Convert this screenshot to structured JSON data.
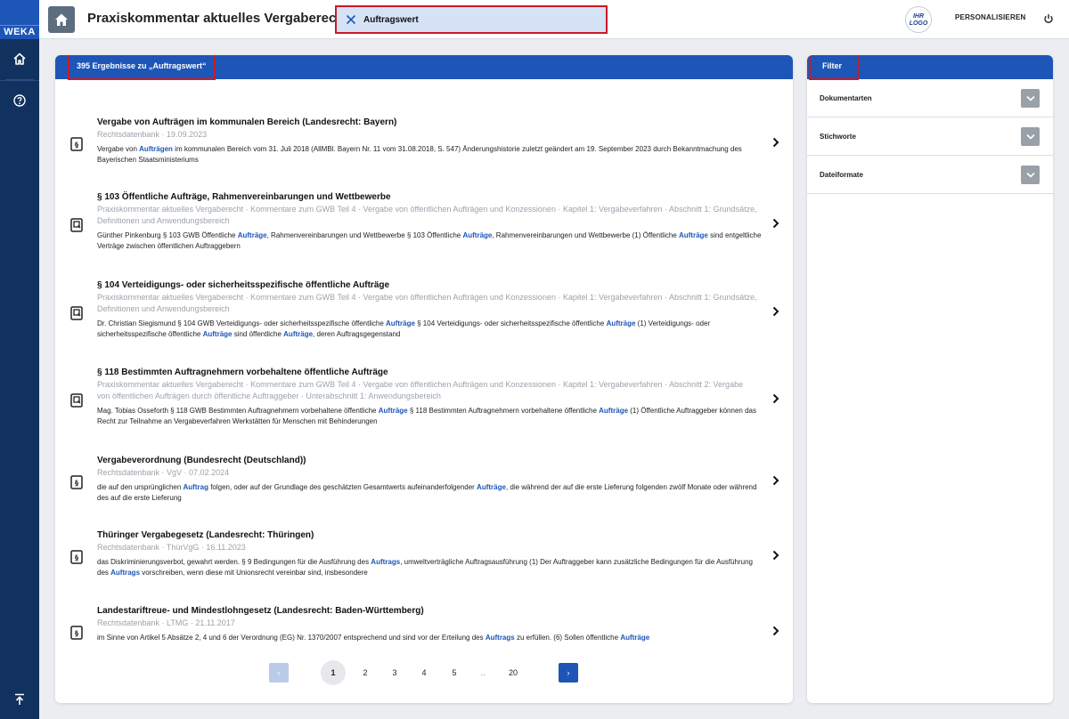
{
  "sidebar": {
    "logo_text": "WEKA"
  },
  "header": {
    "app_title": "Praxiskommentar aktuelles Vergaberecht",
    "search_term": "Auftragswert",
    "user_logo": [
      "IHR",
      "LOGO"
    ],
    "personalize_label": "PERSONALISIEREN"
  },
  "results": {
    "count_label": "395 Ergebnisse zu „Auftragswert“",
    "items": [
      {
        "title": "Vergabe von Aufträgen im kommunalen Bereich (Landesrecht: Bayern)",
        "meta": "Rechtsdatenbank · 19.09.2023",
        "icon": "paragraph-document-icon",
        "snippet": [
          {
            "t": "Vergabe von "
          },
          {
            "t": "Aufträgen",
            "h": true
          },
          {
            "t": " im kommunalen Bereich vom 31. Juli 2018 (AllMBl. Bayern Nr. 11 vom 31.08.2018, S. 547) Änderungshistorie zuletzt geändert am 19. September 2023 durch Bekanntmachung des Bayerischen Staatsministeriums"
          }
        ]
      },
      {
        "title": "§ 103 Öffentliche Aufträge, Rahmenvereinbarungen und Wettbewerbe",
        "meta": "Praxiskommentar aktuelles Vergaberecht · Kommentare zum GWB Teil 4 · Vergabe von öffentlichen Aufträgen und Konzessionen · Kapitel 1: Vergabeverfahren · Abschnitt 1: Grundsätze, Definitionen und Anwendungsbereich",
        "icon": "commentary-document-icon",
        "snippet": [
          {
            "t": "Günther Pinkenburg § 103 GWB Öffentliche "
          },
          {
            "t": "Aufträge",
            "h": true
          },
          {
            "t": ", Rahmenvereinbarungen und Wettbewerbe § 103 Öffentliche "
          },
          {
            "t": "Aufträge",
            "h": true
          },
          {
            "t": ", Rahmenvereinbarungen und Wettbewerbe (1) Öffentliche "
          },
          {
            "t": "Aufträge",
            "h": true
          },
          {
            "t": " sind entgeltliche Verträge zwischen öffentlichen Auftraggebern"
          }
        ]
      },
      {
        "title": "§ 104 Verteidigungs- oder sicherheitsspezifische öffentliche Aufträge",
        "meta": "Praxiskommentar aktuelles Vergaberecht · Kommentare zum GWB Teil 4 · Vergabe von öffentlichen Aufträgen und Konzessionen · Kapitel 1: Vergabeverfahren · Abschnitt 1: Grundsätze, Definitionen und Anwendungsbereich",
        "icon": "commentary-document-icon",
        "snippet": [
          {
            "t": "Dr. Christian Siegismund § 104 GWB Verteidigungs- oder sicherheitsspezifische öffentliche "
          },
          {
            "t": "Aufträge",
            "h": true
          },
          {
            "t": " § 104 Verteidigungs- oder sicherheitsspezifische öffentliche "
          },
          {
            "t": "Aufträge",
            "h": true
          },
          {
            "t": " (1) Verteidigungs- oder sicherheitsspezifische öffentliche "
          },
          {
            "t": "Aufträge",
            "h": true
          },
          {
            "t": " sind öffentliche "
          },
          {
            "t": "Aufträge",
            "h": true
          },
          {
            "t": ", deren Auftragsgegenstand"
          }
        ]
      },
      {
        "title": "§ 118 Bestimmten Auftragnehmern vorbehaltene öffentliche Aufträge",
        "meta": "Praxiskommentar aktuelles Vergaberecht · Kommentare zum GWB Teil 4 · Vergabe von öffentlichen Aufträgen und Konzessionen · Kapitel 1: Vergabeverfahren · Abschnitt 2: Vergabe von öffentlichen Aufträgen durch öffentliche Auftraggeber · Unterabschnitt 1: Anwendungsbereich",
        "icon": "commentary-document-icon",
        "snippet": [
          {
            "t": "Mag. Tobias Osseforth § 118 GWB Bestimmten Auftragnehmern vorbehaltene öffentliche "
          },
          {
            "t": "Aufträge",
            "h": true
          },
          {
            "t": " § 118 Bestimmten Auftragnehmern vorbehaltene öffentliche "
          },
          {
            "t": "Aufträge",
            "h": true
          },
          {
            "t": " (1) Öffentliche Auftraggeber können das Recht zur Teilnahme an Vergabeverfahren Werkstätten für Menschen mit Behinderungen"
          }
        ]
      },
      {
        "title": "Vergabeverordnung (Bundesrecht (Deutschland))",
        "meta": "Rechtsdatenbank · VgV · 07.02.2024",
        "icon": "paragraph-document-icon",
        "snippet": [
          {
            "t": "die auf den ursprünglichen "
          },
          {
            "t": "Auftrag",
            "h": true
          },
          {
            "t": " folgen, oder auf der Grundlage des geschätzten Gesamtwerts aufeinanderfolgender "
          },
          {
            "t": "Aufträge",
            "h": true
          },
          {
            "t": ", die während der auf die erste Lieferung folgenden zwölf Monate oder während des auf die erste Lieferung"
          }
        ]
      },
      {
        "title": "Thüringer Vergabegesetz (Landesrecht: Thüringen)",
        "meta": "Rechtsdatenbank · ThürVgG · 16.11.2023",
        "icon": "paragraph-document-icon",
        "snippet": [
          {
            "t": "das Diskriminierungsverbot, gewahrt werden. § 9 Bedingungen für die Ausführung des "
          },
          {
            "t": "Auftrags",
            "h": true
          },
          {
            "t": ", umweltverträgliche Auftragsausführung (1) Der Auftraggeber kann zusätzliche Bedingungen für die Ausführung des "
          },
          {
            "t": "Auftrags",
            "h": true
          },
          {
            "t": " vorschreiben, wenn diese mit Unionsrecht vereinbar sind, insbesondere"
          }
        ]
      },
      {
        "title": "Landestariftreue- und Mindestlohngesetz (Landesrecht: Baden-Württemberg)",
        "meta": "Rechtsdatenbank · LTMG · 21.11.2017",
        "icon": "paragraph-document-icon",
        "snippet": [
          {
            "t": "im Sinne von Artikel 5 Absätze 2, 4 und 6 der Verordnung (EG) Nr. 1370/2007 entsprechend und sind vor der Erteilung des "
          },
          {
            "t": "Auftrags",
            "h": true
          },
          {
            "t": " zu erfüllen. (6) Sollen öffentliche "
          },
          {
            "t": "Aufträge",
            "h": true
          }
        ]
      }
    ]
  },
  "pagination": {
    "prev": "‹",
    "next": "›",
    "pages": [
      "1",
      "2",
      "3",
      "4",
      "5",
      "..",
      "20"
    ],
    "current": "1"
  },
  "filter": {
    "title": "Filter",
    "facets": [
      "Dokumentarten",
      "Stichworte",
      "Dateiformate"
    ]
  },
  "colors": {
    "brand_blue": "#1e56b7",
    "sidebar_navy": "#11315f",
    "highlight_red": "#cc1a26"
  }
}
